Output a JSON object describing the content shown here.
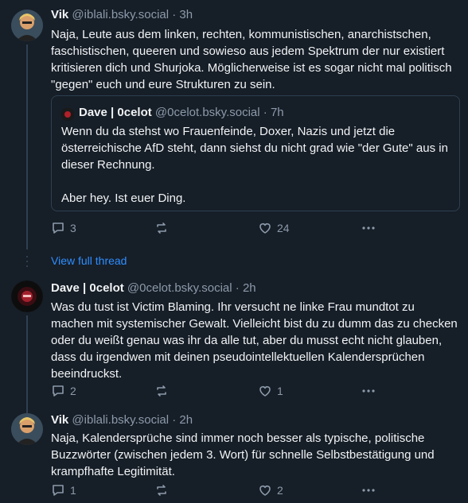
{
  "posts": [
    {
      "name": "Vik",
      "handle": "@iblali.bsky.social",
      "dot": "·",
      "time": "3h",
      "body": "Naja, Leute aus dem linken, rechten, kommunistischen, anarchistschen, faschistischen, queeren und sowieso aus jedem Spektrum der nur existiert kritisieren dich und Shurjoka. Möglicherweise ist es sogar nicht mal politisch \"gegen\" euch und eure Strukturen zu sein.",
      "quote": {
        "name": "Dave | 0celot",
        "handle": "@0celot.bsky.social",
        "dot": "·",
        "time": "7h",
        "body_line1": "Wenn du da stehst wo Frauenfeinde, Doxer, Nazis und jetzt die österreichische AfD steht, dann siehst du nicht grad wie \"der Gute\" aus in dieser Rechnung.",
        "body_line2": "Aber hey. Ist euer Ding."
      },
      "replies": "3",
      "reposts": "",
      "likes": "24"
    },
    {
      "name": "Dave | 0celot",
      "handle": "@0celot.bsky.social",
      "dot": "·",
      "time": "2h",
      "body": "Was du tust ist Victim Blaming. Ihr versucht ne linke Frau mundtot zu machen mit systemischer Gewalt. Vielleicht bist du zu dumm das zu checken oder du weißt genau was ihr da alle tut, aber du musst echt nicht glauben, dass du irgendwen mit deinen pseudointellektuellen Kalendersprüchen beeindruckst.",
      "replies": "2",
      "reposts": "",
      "likes": "1"
    },
    {
      "name": "Vik",
      "handle": "@iblali.bsky.social",
      "dot": "·",
      "time": "2h",
      "body": "Naja, Kalendersprüche sind immer noch besser als typische, politische Buzzwörter (zwischen jedem 3. Wort) für schnelle Selbstbestätigung und krampfhafte Legitimität.",
      "replies": "1",
      "reposts": "",
      "likes": "2"
    }
  ],
  "view_full_thread": "View full thread",
  "colors": {
    "background": "#161e27",
    "text": "#f1f3f5",
    "muted": "#8c9aab",
    "link": "#2f8eff"
  },
  "icons": [
    "reply-icon",
    "repost-icon",
    "like-icon",
    "more-icon"
  ]
}
